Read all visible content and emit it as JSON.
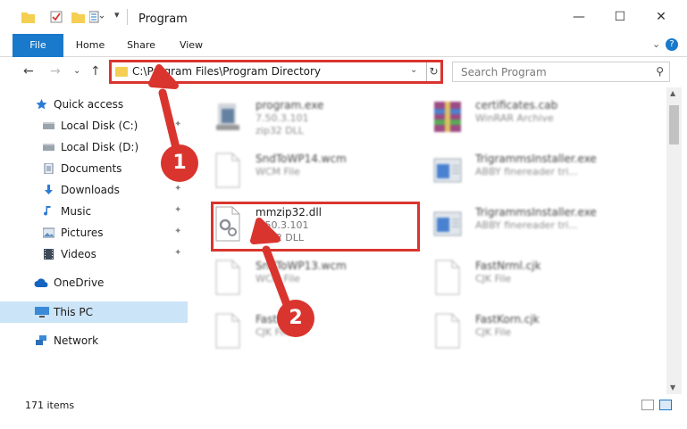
{
  "window": {
    "title": "Program",
    "minimize": "—",
    "maximize": "☐",
    "close": "✕"
  },
  "ribbon": {
    "tabs": [
      "File",
      "Home",
      "Share",
      "View"
    ],
    "help": "?",
    "expand": "⌄"
  },
  "nav": {
    "back": "←",
    "forward": "→",
    "recent": "⌄",
    "up": "↑"
  },
  "address": {
    "path": "C:\\Program Files\\Program Directory",
    "dropdown": "⌄",
    "refresh": "↻"
  },
  "search": {
    "placeholder": "Search Program",
    "icon": "⚲"
  },
  "sidebar": {
    "items": [
      {
        "label": "Quick access",
        "icon": "star-icon",
        "pinned": false
      },
      {
        "label": "Local Disk (C:)",
        "icon": "drive-icon",
        "pinned": true
      },
      {
        "label": "Local Disk (D:)",
        "icon": "drive-icon",
        "pinned": false
      },
      {
        "label": "Documents",
        "icon": "documents-icon",
        "pinned": true
      },
      {
        "label": "Downloads",
        "icon": "download-icon",
        "pinned": true
      },
      {
        "label": "Music",
        "icon": "music-icon",
        "pinned": true
      },
      {
        "label": "Pictures",
        "icon": "pictures-icon",
        "pinned": true
      },
      {
        "label": "Videos",
        "icon": "videos-icon",
        "pinned": true
      },
      {
        "label": "OneDrive",
        "icon": "cloud-icon",
        "pinned": false
      },
      {
        "label": "This PC",
        "icon": "computer-icon",
        "pinned": false,
        "selected": true
      },
      {
        "label": "Network",
        "icon": "network-icon",
        "pinned": false
      }
    ],
    "pin_glyph": "📌"
  },
  "files": [
    {
      "name": "program.exe",
      "line2": "7.50.3.101",
      "line3": "zip32 DLL",
      "icon": "installer-icon"
    },
    {
      "name": "certificates.cab",
      "line2": "WinRAR Archive",
      "line3": "",
      "icon": "archive-icon"
    },
    {
      "name": "SndToWP14.wcm",
      "line2": "WCM File",
      "line3": "",
      "icon": "blank-file-icon"
    },
    {
      "name": "TrigrammsInstaller.exe",
      "line2": "ABBY finereader tri...",
      "line3": "",
      "icon": "app-icon"
    },
    {
      "name": "mmzip32.dll",
      "line2": "7.50.3.101",
      "line3": "zip32 DLL",
      "icon": "dll-gear-icon"
    },
    {
      "name": "TrigrammsInstaller.exe",
      "line2": "ABBY finereader tri...",
      "line3": "",
      "icon": "app-icon"
    },
    {
      "name": "SndToWP13.wcm",
      "line2": "WCM File",
      "line3": "",
      "icon": "blank-file-icon"
    },
    {
      "name": "FastNrml.cjk",
      "line2": "CJK File",
      "line3": "",
      "icon": "blank-file-icon"
    },
    {
      "name": "FastKor.cjk",
      "line2": "CJK File",
      "line3": "",
      "icon": "blank-file-icon"
    },
    {
      "name": "FastKorn.cjk",
      "line2": "CJK File",
      "line3": "",
      "icon": "blank-file-icon"
    }
  ],
  "status": {
    "count": "171 items"
  },
  "annotations": [
    "1",
    "2"
  ],
  "colors": {
    "accent": "#1979ca",
    "highlight": "#d9352e",
    "selected": "#cce4f7"
  }
}
